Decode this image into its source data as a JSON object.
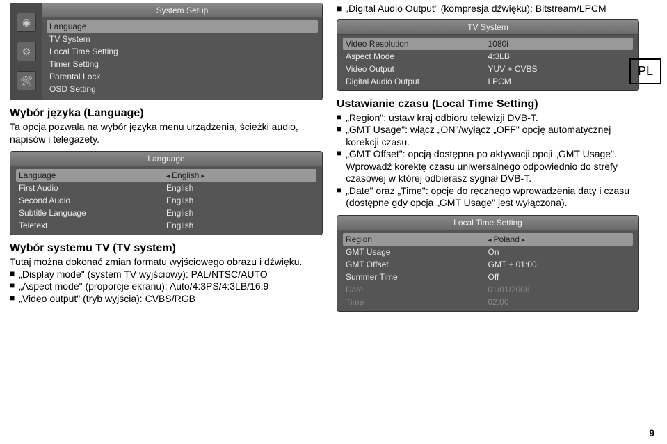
{
  "pl_label": "PL",
  "page_number": "9",
  "top_note": {
    "prefix": "■ ",
    "text": "„Digital Audio Output\" (kompresja dźwięku): Bitstream/LPCM"
  },
  "setup_panel": {
    "title": "System Setup",
    "items": [
      "Language",
      "TV System",
      "Local Time Setting",
      "Timer Setting",
      "Parental Lock",
      "OSD Setting"
    ],
    "icons": [
      "disc-icon",
      "gear-icon",
      "wrench-icon"
    ]
  },
  "tv_panel": {
    "title": "TV System",
    "rows": [
      {
        "k": "Video Resolution",
        "v": "1080i",
        "hi": true
      },
      {
        "k": "Aspect Mode",
        "v": "4:3LB"
      },
      {
        "k": "Video Output",
        "v": "YUV + CVBS"
      },
      {
        "k": "Digital Audio Output",
        "v": "LPCM"
      }
    ]
  },
  "lang_panel": {
    "title": "Language",
    "rows": [
      {
        "k": "Language",
        "v": "English",
        "hi": true,
        "arrows": true
      },
      {
        "k": "First Audio",
        "v": "English"
      },
      {
        "k": "Second Audio",
        "v": "English"
      },
      {
        "k": "Subtitle Language",
        "v": "English"
      },
      {
        "k": "Teletext",
        "v": "English"
      }
    ]
  },
  "time_panel": {
    "title": "Local Time Setting",
    "rows": [
      {
        "k": "Region",
        "v": "Poland",
        "hi": true,
        "arrows": true
      },
      {
        "k": "GMT Usage",
        "v": "On"
      },
      {
        "k": "GMT Offset",
        "v": "GMT + 01:00"
      },
      {
        "k": "Summer Time",
        "v": "Off"
      },
      {
        "k": "Date",
        "v": "01/01/2008",
        "dim": true
      },
      {
        "k": "Time",
        "v": "02:00",
        "dim": true
      }
    ]
  },
  "section_lang": {
    "heading": "Wybór języka (Language)",
    "para": "Ta opcja pozwala na wybór języka menu urządzenia, ścieżki audio, napisów i telegazety."
  },
  "section_tv": {
    "heading": "Wybór systemu TV (TV system)",
    "intro": "Tutaj można dokonać zmian formatu wyjściowego obrazu i dźwięku.",
    "bullets": [
      "„Display mode\" (system TV wyjściowy): PAL/NTSC/AUTO",
      "„Aspect mode\" (proporcje ekranu): Auto/4:3PS/4:3LB/16:9",
      "„Video output\" (tryb wyjścia): CVBS/RGB"
    ]
  },
  "section_time": {
    "heading": "Ustawianie czasu (Local Time Setting)",
    "bullets": [
      "„Region\": ustaw kraj odbioru telewizji DVB-T.",
      "„GMT Usage\": włącz „ON\"/wyłącz „OFF\" opcję automatycznej korekcji czasu.",
      "„GMT Offset\": opcją dostępna po aktywacji opcji „GMT Usage\". Wprowadź korektę czasu uniwersalnego odpowiednio do strefy czasowej w której odbierasz sygnał DVB-T.",
      "„Date\" oraz „Time\": opcje do ręcznego wprowadzenia daty i czasu (dostępne gdy opcja „GMT Usage\" jest wyłączona)."
    ]
  }
}
